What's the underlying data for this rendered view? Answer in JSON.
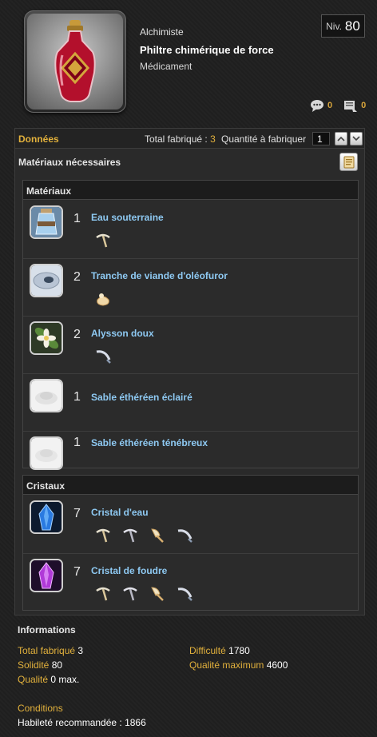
{
  "item": {
    "job": "Alchimiste",
    "name": "Philtre chimérique de force",
    "type": "Médicament",
    "level_label": "Niv.",
    "level_value": "80",
    "comments_count": "0",
    "lists_count": "0"
  },
  "data_bar": {
    "title": "Données",
    "total_made_label": "Total fabriqué :",
    "total_made_value": "3",
    "qty_label": "Quantité à fabriquer",
    "qty_value": "1"
  },
  "materials_section": {
    "title": "Matériaux nécessaires"
  },
  "materials": {
    "header": "Matériaux",
    "items": [
      {
        "qty": "1",
        "name": "Eau souterraine",
        "icon": "water-flask-icon",
        "tools": [
          "pickaxe-icon"
        ]
      },
      {
        "qty": "2",
        "name": "Tranche de viande d'oléofuror",
        "icon": "meat-slice-icon",
        "tools": [
          "bait-icon"
        ]
      },
      {
        "qty": "2",
        "name": "Alysson doux",
        "icon": "flower-icon",
        "tools": [
          "sickle-icon"
        ]
      },
      {
        "qty": "1",
        "name": "Sable éthéréen éclairé",
        "icon": "sand-icon",
        "tools": []
      },
      {
        "qty": "1",
        "name": "Sable éthéréen ténébreux",
        "icon": "sand-icon",
        "tools": []
      }
    ]
  },
  "crystals": {
    "header": "Cristaux",
    "items": [
      {
        "qty": "7",
        "name": "Cristal d'eau",
        "icon": "water-crystal-icon",
        "tools": [
          "pickaxe-icon",
          "pickaxe-icon",
          "hatchet-icon",
          "sickle-icon"
        ]
      },
      {
        "qty": "7",
        "name": "Cristal de foudre",
        "icon": "lightning-crystal-icon",
        "tools": [
          "pickaxe-icon",
          "pickaxe-icon",
          "hatchet-icon",
          "sickle-icon"
        ]
      }
    ]
  },
  "info": {
    "title": "Informations",
    "total_label": "Total fabriqué",
    "total_value": "3",
    "durability_label": "Solidité",
    "durability_value": "80",
    "quality_label": "Qualité",
    "quality_value": "0 max.",
    "difficulty_label": "Difficulté",
    "difficulty_value": "1780",
    "max_quality_label": "Qualité maximum",
    "max_quality_value": "4600"
  },
  "conditions": {
    "title": "Conditions",
    "line": "Habileté recommandée : 1866"
  },
  "colors": {
    "accent": "#e2b13c",
    "link": "#8ec9f2",
    "background": "#1f1f1f"
  }
}
